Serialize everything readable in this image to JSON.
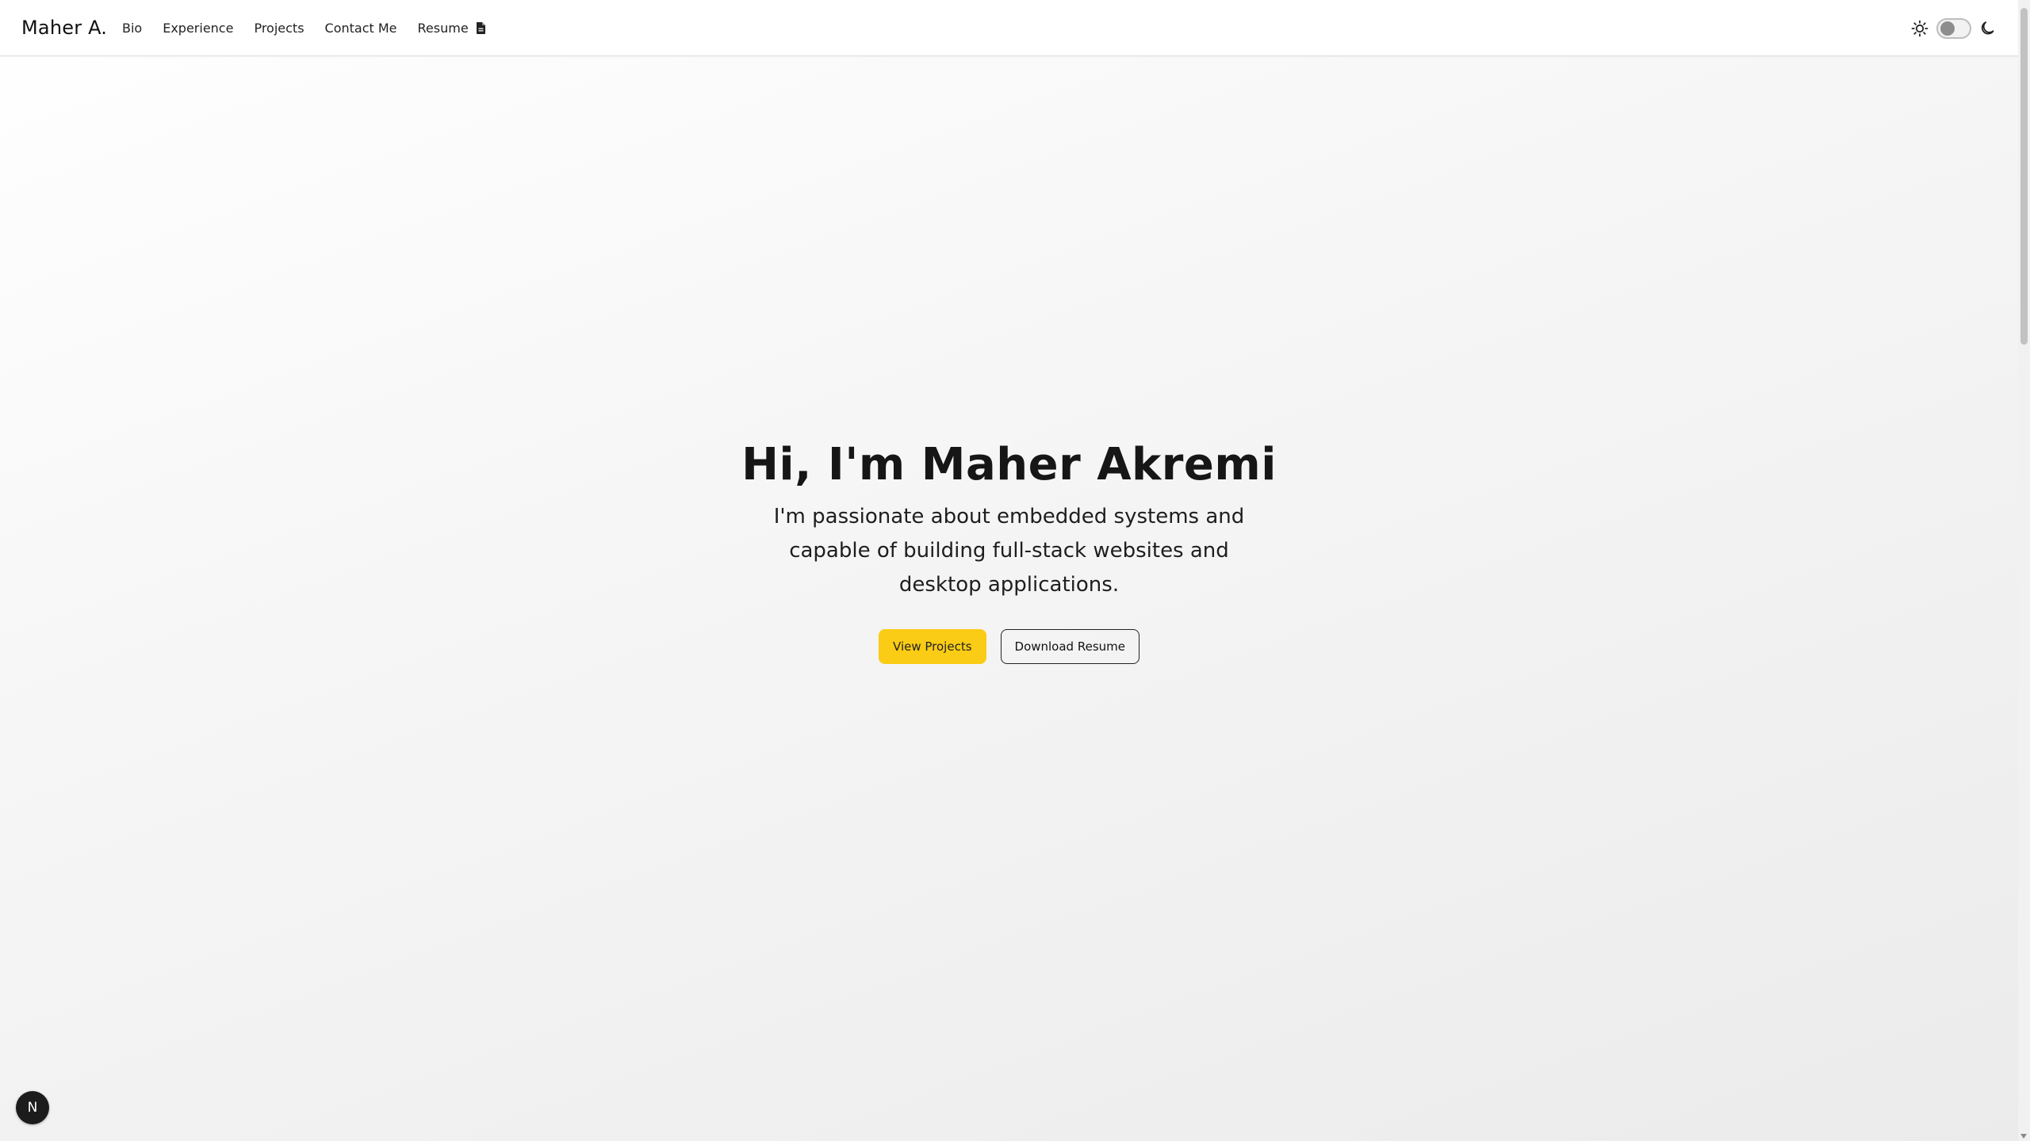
{
  "nav": {
    "brand": "Maher A.",
    "links": [
      {
        "label": "Bio"
      },
      {
        "label": "Experience"
      },
      {
        "label": "Projects"
      },
      {
        "label": "Contact Me"
      },
      {
        "label": "Resume",
        "icon": "document-icon"
      }
    ],
    "theme_toggle": {
      "state": "light",
      "left_icon": "sun-icon",
      "right_icon": "moon-icon"
    }
  },
  "hero": {
    "title": "Hi, I'm Maher Akremi",
    "subtitle": "I'm passionate about embedded systems and capable of building full-stack websites and desktop applications.",
    "primary_button": "View Projects",
    "secondary_button": "Download Resume"
  },
  "badge": {
    "letter": "N"
  },
  "colors": {
    "accent": "#facc15",
    "text": "#111111",
    "badge_bg": "#1c1c1c"
  }
}
